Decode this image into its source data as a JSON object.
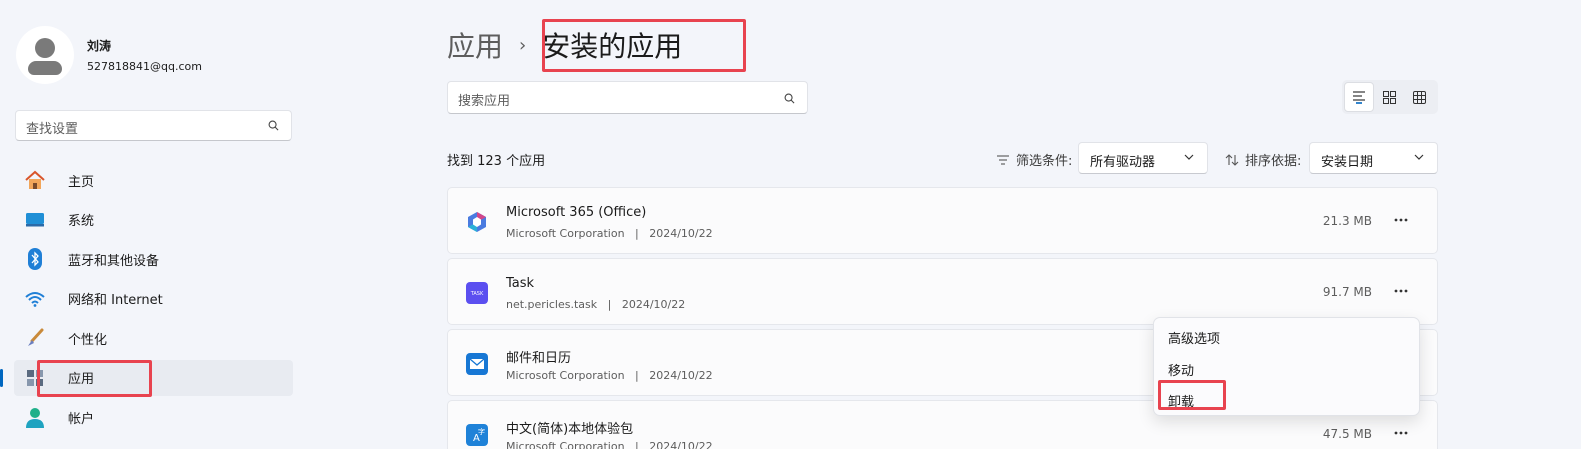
{
  "profile": {
    "name": "刘涛",
    "email": "527818841@qq.com"
  },
  "sidebar": {
    "search_placeholder": "查找设置",
    "items": [
      {
        "label": "主页",
        "icon": "home-icon"
      },
      {
        "label": "系统",
        "icon": "monitor-icon"
      },
      {
        "label": "蓝牙和其他设备",
        "icon": "bluetooth-icon"
      },
      {
        "label": "网络和 Internet",
        "icon": "wifi-icon"
      },
      {
        "label": "个性化",
        "icon": "brush-icon"
      },
      {
        "label": "应用",
        "icon": "apps-icon"
      },
      {
        "label": "帐户",
        "icon": "account-icon"
      }
    ],
    "active_index": 5
  },
  "header": {
    "parent": "应用",
    "separator": "›",
    "current": "安装的应用"
  },
  "search_apps": {
    "placeholder": "搜索应用"
  },
  "toolbar": {
    "count_label": "找到 123 个应用",
    "filter_label": "筛选条件:",
    "filter_value": "所有驱动器",
    "sort_label": "排序依据:",
    "sort_value": "安装日期"
  },
  "apps": [
    {
      "name": "Microsoft 365 (Office)",
      "publisher": "Microsoft Corporation",
      "date": "2024/10/22",
      "size": "21.3 MB",
      "icon": "office-icon"
    },
    {
      "name": "Task",
      "publisher": "net.pericles.task",
      "date": "2024/10/22",
      "size": "91.7 MB",
      "icon": "task-icon"
    },
    {
      "name": "邮件和日历",
      "publisher": "Microsoft Corporation",
      "date": "2024/10/22",
      "size": "",
      "icon": "mail-calendar-icon"
    },
    {
      "name": "中文(简体)本地体验包",
      "publisher": "Microsoft Corporation",
      "date": "2024/10/22",
      "size": "47.5 MB",
      "icon": "language-pack-icon"
    }
  ],
  "context_menu": {
    "items": [
      "高级选项",
      "移动",
      "卸载"
    ]
  },
  "colors": {
    "accent": "#0067c0",
    "highlight": "#e8434f",
    "background": "#f3f5fa"
  }
}
